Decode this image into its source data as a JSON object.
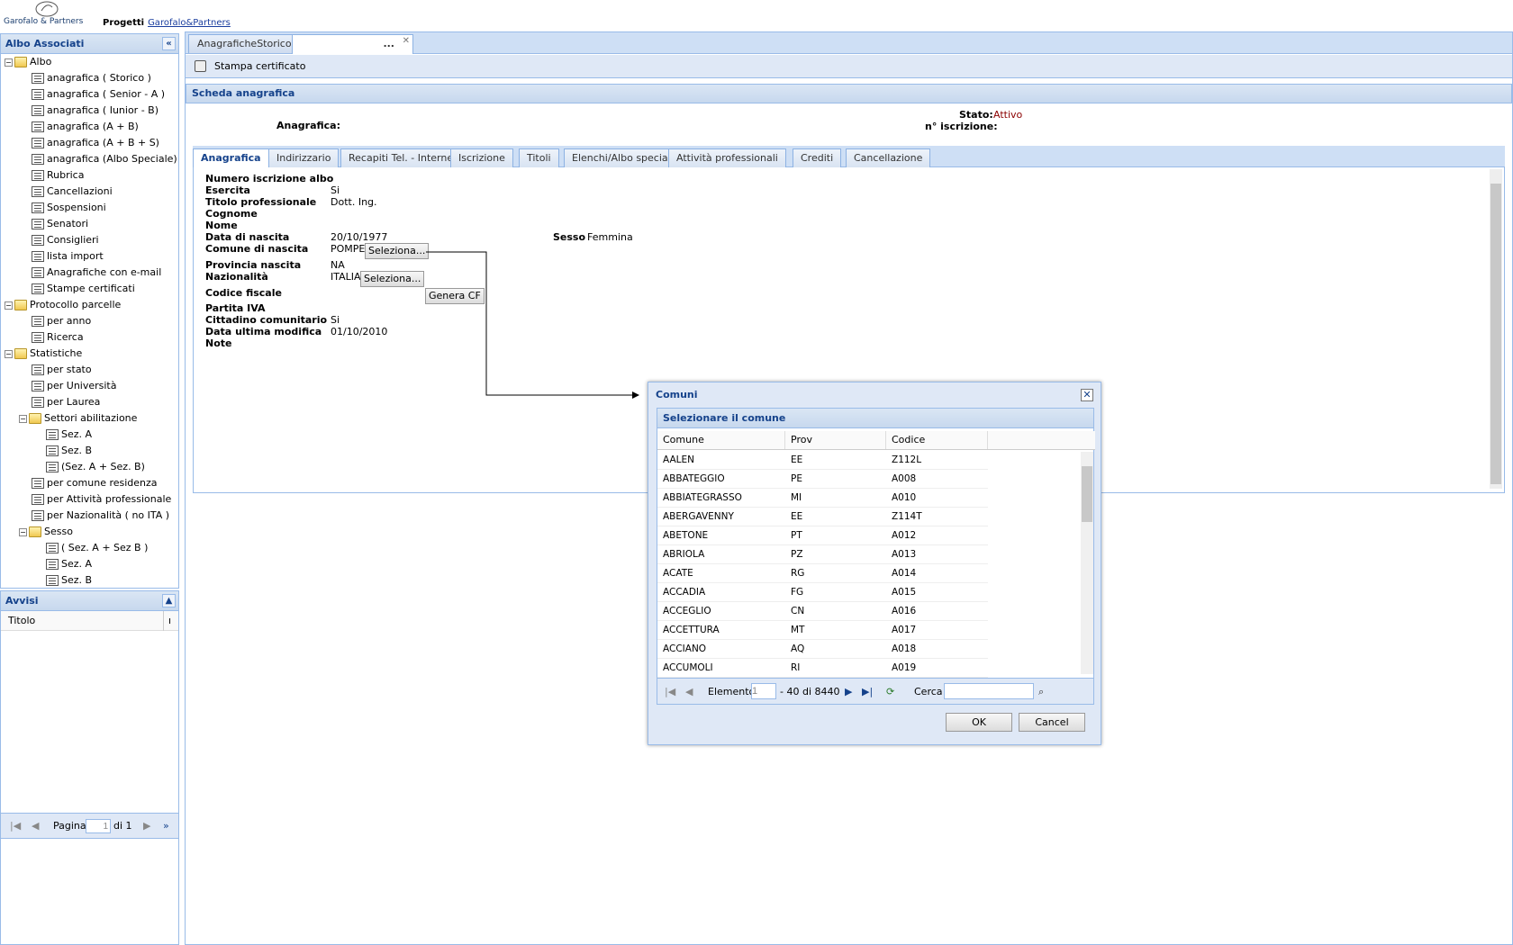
{
  "header": {
    "company": "Garofalo & Partners",
    "projects_label": "Progetti",
    "projects_link": "Garofalo&Partners"
  },
  "west": {
    "title": "Albo Associati",
    "tree": [
      {
        "label": "Albo",
        "type": "folder",
        "level": 0
      },
      {
        "label": "anagrafica ( Storico )",
        "type": "leaf",
        "level": 1
      },
      {
        "label": "anagrafica ( Senior - A )",
        "type": "leaf",
        "level": 1
      },
      {
        "label": "anagrafica ( Iunior - B)",
        "type": "leaf",
        "level": 1
      },
      {
        "label": "anagrafica (A + B)",
        "type": "leaf",
        "level": 1
      },
      {
        "label": "anagrafica (A + B + S)",
        "type": "leaf",
        "level": 1
      },
      {
        "label": "anagrafica (Albo Speciale)",
        "type": "leaf",
        "level": 1
      },
      {
        "label": "Rubrica",
        "type": "leaf",
        "level": 1
      },
      {
        "label": "Cancellazioni",
        "type": "leaf",
        "level": 1
      },
      {
        "label": "Sospensioni",
        "type": "leaf",
        "level": 1
      },
      {
        "label": "Senatori",
        "type": "leaf",
        "level": 1
      },
      {
        "label": "Consiglieri",
        "type": "leaf",
        "level": 1
      },
      {
        "label": "lista import",
        "type": "leaf",
        "level": 1
      },
      {
        "label": "Anagrafiche con e-mail",
        "type": "leaf",
        "level": 1
      },
      {
        "label": "Stampe certificati",
        "type": "leaf",
        "level": 1
      },
      {
        "label": "Protocollo parcelle",
        "type": "folder",
        "level": 0
      },
      {
        "label": "per anno",
        "type": "leaf",
        "level": 1
      },
      {
        "label": "Ricerca",
        "type": "leaf",
        "level": 1
      },
      {
        "label": "Statistiche",
        "type": "folder",
        "level": 0
      },
      {
        "label": "per stato",
        "type": "leaf",
        "level": 1
      },
      {
        "label": "per Università",
        "type": "leaf",
        "level": 1
      },
      {
        "label": "per Laurea",
        "type": "leaf",
        "level": 1
      },
      {
        "label": "Settori abilitazione",
        "type": "folder",
        "level": 1
      },
      {
        "label": "Sez. A",
        "type": "leaf",
        "level": 2
      },
      {
        "label": "Sez. B",
        "type": "leaf",
        "level": 2
      },
      {
        "label": "(Sez. A + Sez. B)",
        "type": "leaf",
        "level": 2
      },
      {
        "label": "per comune residenza",
        "type": "leaf",
        "level": 1
      },
      {
        "label": "per Attività professionale",
        "type": "leaf",
        "level": 1
      },
      {
        "label": "per Nazionalità ( no ITA )",
        "type": "leaf",
        "level": 1
      },
      {
        "label": "Sesso",
        "type": "folder",
        "level": 1
      },
      {
        "label": "( Sez. A + Sez B )",
        "type": "leaf",
        "level": 2
      },
      {
        "label": "Sez. A",
        "type": "leaf",
        "level": 2
      },
      {
        "label": "Sez. B",
        "type": "leaf",
        "level": 2
      }
    ]
  },
  "avvisi": {
    "title": "Avvisi",
    "column": "Titolo",
    "column_extra": "ı",
    "page_label": "Pagina",
    "page_value": "1",
    "page_of": "di 1"
  },
  "center": {
    "tabs": [
      "AnagraficheStorico",
      "..."
    ],
    "toolbar": {
      "print_label": "Stampa certificato"
    },
    "panel_title": "Scheda anagrafica",
    "anagrafica_label": "Anagrafica:",
    "stato_label": "Stato:",
    "stato_value": "Attivo",
    "iscrizione_label": "n° iscrizione:",
    "inner_tabs": [
      "Anagrafica",
      "Indirizzario",
      "Recapiti Tel. - Internet",
      "Iscrizione",
      "Titoli",
      "Elenchi/Albo speciali",
      "Attività professionali",
      "Crediti",
      "Cancellazione"
    ],
    "form": {
      "numero_label": "Numero iscrizione albo",
      "esercita_label": "Esercita",
      "esercita_value": "Si",
      "titolo_label": "Titolo professionale",
      "titolo_value": "Dott. Ing.",
      "cognome_label": "Cognome",
      "nome_label": "Nome",
      "nascita_label": "Data di nascita",
      "nascita_value": "20/10/1977",
      "sesso_label": "Sesso",
      "sesso_value": "Femmina",
      "comune_label": "Comune di nascita",
      "comune_value": "POMPEI",
      "seleziona1": "Seleziona...",
      "provincia_label": "Provincia nascita",
      "provincia_value": "NA",
      "nazionalita_label": "Nazionalità",
      "nazionalita_value": "ITALIA",
      "seleziona2": "Seleziona...",
      "cf_label": "Codice fiscale",
      "genera_cf": "Genera CF",
      "piva_label": "Partita IVA",
      "cittadino_label": "Cittadino comunitario",
      "cittadino_value": "Si",
      "modifica_label": "Data ultima modifica",
      "modifica_value": "01/10/2010",
      "note_label": "Note"
    }
  },
  "dialog": {
    "title": "Comuni",
    "subtitle": "Selezionare il comune",
    "columns": [
      "Comune",
      "Prov",
      "Codice"
    ],
    "rows": [
      [
        "AALEN",
        "EE",
        "Z112L"
      ],
      [
        "ABBATEGGIO",
        "PE",
        "A008"
      ],
      [
        "ABBIATEGRASSO",
        "MI",
        "A010"
      ],
      [
        "ABERGAVENNY",
        "EE",
        "Z114T"
      ],
      [
        "ABETONE",
        "PT",
        "A012"
      ],
      [
        "ABRIOLA",
        "PZ",
        "A013"
      ],
      [
        "ACATE",
        "RG",
        "A014"
      ],
      [
        "ACCADIA",
        "FG",
        "A015"
      ],
      [
        "ACCEGLIO",
        "CN",
        "A016"
      ],
      [
        "ACCETTURA",
        "MT",
        "A017"
      ],
      [
        "ACCIANO",
        "AQ",
        "A018"
      ],
      [
        "ACCUMOLI",
        "RI",
        "A019"
      ]
    ],
    "elemento_label": "Elemento",
    "elemento_value": "1",
    "range_label": "- 40 di 8440",
    "cerca_label": "Cerca",
    "cerca_value": "",
    "ok_label": "OK",
    "cancel_label": "Cancel"
  }
}
